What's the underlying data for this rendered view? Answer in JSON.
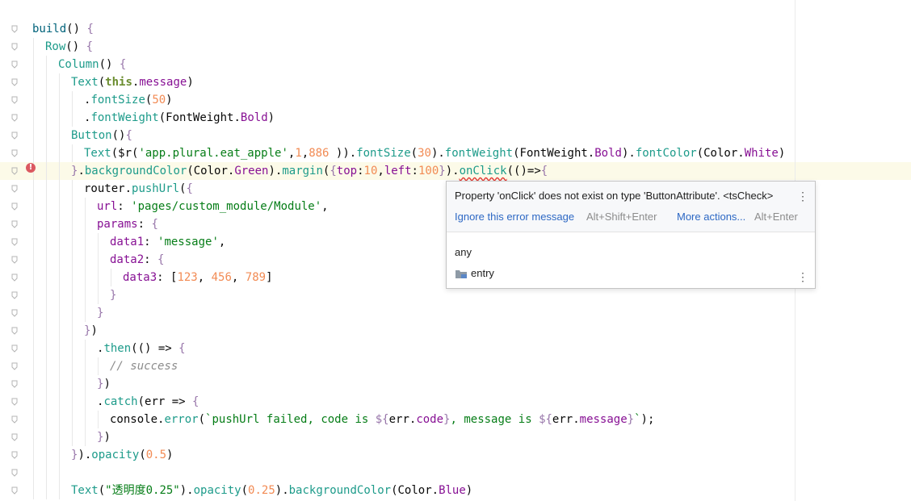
{
  "editor": {
    "lines": [
      {
        "indent": 0,
        "tokens": [
          [
            "k-fn",
            "build"
          ],
          [
            "k-plain",
            "() "
          ],
          [
            "k-brace",
            "{"
          ]
        ]
      },
      {
        "indent": 1,
        "tokens": [
          [
            "k-call",
            "Row"
          ],
          [
            "k-plain",
            "() "
          ],
          [
            "k-brace",
            "{"
          ]
        ]
      },
      {
        "indent": 2,
        "tokens": [
          [
            "k-call",
            "Column"
          ],
          [
            "k-plain",
            "() "
          ],
          [
            "k-brace",
            "{"
          ]
        ]
      },
      {
        "indent": 3,
        "tokens": [
          [
            "k-call",
            "Text"
          ],
          [
            "k-plain",
            "("
          ],
          [
            "k-this",
            "this"
          ],
          [
            "k-plain",
            "."
          ],
          [
            "k-prop",
            "message"
          ],
          [
            "k-plain",
            ")"
          ]
        ]
      },
      {
        "indent": 4,
        "tokens": [
          [
            "k-plain",
            "."
          ],
          [
            "k-call",
            "fontSize"
          ],
          [
            "k-plain",
            "("
          ],
          [
            "k-num",
            "50"
          ],
          [
            "k-plain",
            ")"
          ]
        ]
      },
      {
        "indent": 4,
        "tokens": [
          [
            "k-plain",
            "."
          ],
          [
            "k-call",
            "fontWeight"
          ],
          [
            "k-plain",
            "("
          ],
          [
            "k-plain",
            "FontWeight"
          ],
          [
            "k-plain",
            "."
          ],
          [
            "k-prop",
            "Bold"
          ],
          [
            "k-plain",
            ")"
          ]
        ]
      },
      {
        "indent": 3,
        "tokens": [
          [
            "k-call",
            "Button"
          ],
          [
            "k-plain",
            "()"
          ],
          [
            "k-brace",
            "{"
          ]
        ]
      },
      {
        "indent": 4,
        "tokens": [
          [
            "k-call",
            "Text"
          ],
          [
            "k-plain",
            "($r("
          ],
          [
            "k-str",
            "'app.plural.eat_apple'"
          ],
          [
            "k-plain",
            ","
          ],
          [
            "k-num",
            "1"
          ],
          [
            "k-plain",
            ","
          ],
          [
            "k-num",
            "886"
          ],
          [
            "k-plain",
            " ))."
          ],
          [
            "k-call",
            "fontSize"
          ],
          [
            "k-plain",
            "("
          ],
          [
            "k-num",
            "30"
          ],
          [
            "k-plain",
            ")."
          ],
          [
            "k-call",
            "fontWeight"
          ],
          [
            "k-plain",
            "(FontWeight."
          ],
          [
            "k-prop",
            "Bold"
          ],
          [
            "k-plain",
            ")."
          ],
          [
            "k-call",
            "fontColor"
          ],
          [
            "k-plain",
            "(Color."
          ],
          [
            "k-prop",
            "White"
          ],
          [
            "k-plain",
            ")"
          ]
        ]
      },
      {
        "indent": 3,
        "highlight": true,
        "tokens": [
          [
            "k-brace",
            "}"
          ],
          [
            "k-plain",
            "."
          ],
          [
            "k-call",
            "backgroundColor"
          ],
          [
            "k-plain",
            "(Color."
          ],
          [
            "k-prop",
            "Green"
          ],
          [
            "k-plain",
            ")."
          ],
          [
            "k-call",
            "margin"
          ],
          [
            "k-plain",
            "("
          ],
          [
            "k-brace",
            "{"
          ],
          [
            "k-prop",
            "top"
          ],
          [
            "k-plain",
            ":"
          ],
          [
            "k-num",
            "10"
          ],
          [
            "k-plain",
            ","
          ],
          [
            "k-prop",
            "left"
          ],
          [
            "k-plain",
            ":"
          ],
          [
            "k-num",
            "100"
          ],
          [
            "k-brace",
            "}"
          ],
          [
            "k-plain",
            ")."
          ],
          [
            "k-call squiggle",
            "onClick"
          ],
          [
            "k-plain",
            "(()"
          ],
          [
            "k-plain",
            "=>"
          ],
          [
            "k-brace",
            "{"
          ]
        ]
      },
      {
        "indent": 4,
        "tokens": [
          [
            "k-plain",
            "router."
          ],
          [
            "k-call",
            "pushUrl"
          ],
          [
            "k-plain",
            "("
          ],
          [
            "k-brace",
            "{"
          ]
        ]
      },
      {
        "indent": 5,
        "tokens": [
          [
            "k-prop",
            "url"
          ],
          [
            "k-plain",
            ": "
          ],
          [
            "k-str",
            "'pages/custom_module/Module'"
          ],
          [
            "k-plain",
            ","
          ]
        ]
      },
      {
        "indent": 5,
        "tokens": [
          [
            "k-prop",
            "params"
          ],
          [
            "k-plain",
            ": "
          ],
          [
            "k-brace",
            "{"
          ]
        ]
      },
      {
        "indent": 6,
        "tokens": [
          [
            "k-prop",
            "data1"
          ],
          [
            "k-plain",
            ": "
          ],
          [
            "k-str",
            "'message'"
          ],
          [
            "k-plain",
            ","
          ]
        ]
      },
      {
        "indent": 6,
        "tokens": [
          [
            "k-prop",
            "data2"
          ],
          [
            "k-plain",
            ": "
          ],
          [
            "k-brace",
            "{"
          ]
        ]
      },
      {
        "indent": 7,
        "tokens": [
          [
            "k-prop",
            "data3"
          ],
          [
            "k-plain",
            ": ["
          ],
          [
            "k-num",
            "123"
          ],
          [
            "k-plain",
            ", "
          ],
          [
            "k-num",
            "456"
          ],
          [
            "k-plain",
            ", "
          ],
          [
            "k-num",
            "789"
          ],
          [
            "k-plain",
            "]"
          ]
        ]
      },
      {
        "indent": 6,
        "tokens": [
          [
            "k-brace",
            "}"
          ]
        ]
      },
      {
        "indent": 5,
        "tokens": [
          [
            "k-brace",
            "}"
          ]
        ]
      },
      {
        "indent": 4,
        "tokens": [
          [
            "k-brace",
            "}"
          ],
          [
            "k-plain",
            ")"
          ]
        ]
      },
      {
        "indent": 5,
        "tokens": [
          [
            "k-plain",
            "."
          ],
          [
            "k-call",
            "then"
          ],
          [
            "k-plain",
            "(() "
          ],
          [
            "k-plain",
            "=> "
          ],
          [
            "k-brace",
            "{"
          ]
        ]
      },
      {
        "indent": 6,
        "tokens": [
          [
            "k-comment",
            "// success"
          ]
        ]
      },
      {
        "indent": 5,
        "tokens": [
          [
            "k-brace",
            "}"
          ],
          [
            "k-plain",
            ")"
          ]
        ]
      },
      {
        "indent": 5,
        "tokens": [
          [
            "k-plain",
            "."
          ],
          [
            "k-call",
            "catch"
          ],
          [
            "k-plain",
            "(err "
          ],
          [
            "k-plain",
            "=> "
          ],
          [
            "k-brace",
            "{"
          ]
        ]
      },
      {
        "indent": 6,
        "tokens": [
          [
            "k-plain",
            "console."
          ],
          [
            "k-call",
            "error"
          ],
          [
            "k-plain",
            "("
          ],
          [
            "k-str",
            "`pushUrl failed, code is "
          ],
          [
            "k-brace",
            "${"
          ],
          [
            "k-plain",
            "err."
          ],
          [
            "k-prop",
            "code"
          ],
          [
            "k-brace",
            "}"
          ],
          [
            "k-str",
            ", message is "
          ],
          [
            "k-brace",
            "${"
          ],
          [
            "k-plain",
            "err."
          ],
          [
            "k-prop",
            "message"
          ],
          [
            "k-brace",
            "}"
          ],
          [
            "k-str",
            "`"
          ],
          [
            "k-plain",
            ");"
          ]
        ]
      },
      {
        "indent": 5,
        "tokens": [
          [
            "k-brace",
            "}"
          ],
          [
            "k-plain",
            ")"
          ]
        ]
      },
      {
        "indent": 3,
        "tokens": [
          [
            "k-brace",
            "}"
          ],
          [
            "k-plain",
            ")."
          ],
          [
            "k-call",
            "opacity"
          ],
          [
            "k-plain",
            "("
          ],
          [
            "k-num",
            "0.5"
          ],
          [
            "k-plain",
            ")"
          ]
        ]
      },
      {
        "indent": 3,
        "tokens": []
      },
      {
        "indent": 3,
        "tokens": [
          [
            "k-call",
            "Text"
          ],
          [
            "k-plain",
            "("
          ],
          [
            "k-str",
            "\"透明度0.25\""
          ],
          [
            "k-plain",
            ")."
          ],
          [
            "k-call",
            "opacity"
          ],
          [
            "k-plain",
            "("
          ],
          [
            "k-num",
            "0.25"
          ],
          [
            "k-plain",
            ")."
          ],
          [
            "k-call",
            "backgroundColor"
          ],
          [
            "k-plain",
            "(Color."
          ],
          [
            "k-prop",
            "Blue"
          ],
          [
            "k-plain",
            ")"
          ]
        ]
      }
    ]
  },
  "popup": {
    "message": "Property 'onClick' does not exist on type 'ButtonAttribute'. <tsCheck>",
    "action_ignore": "Ignore this error message",
    "shortcut_ignore": "Alt+Shift+Enter",
    "action_more": "More actions...",
    "shortcut_more": "Alt+Enter",
    "type": "any",
    "module": "entry",
    "menu_icon": "more-vertical-icon",
    "module_icon": "folder-icon"
  }
}
